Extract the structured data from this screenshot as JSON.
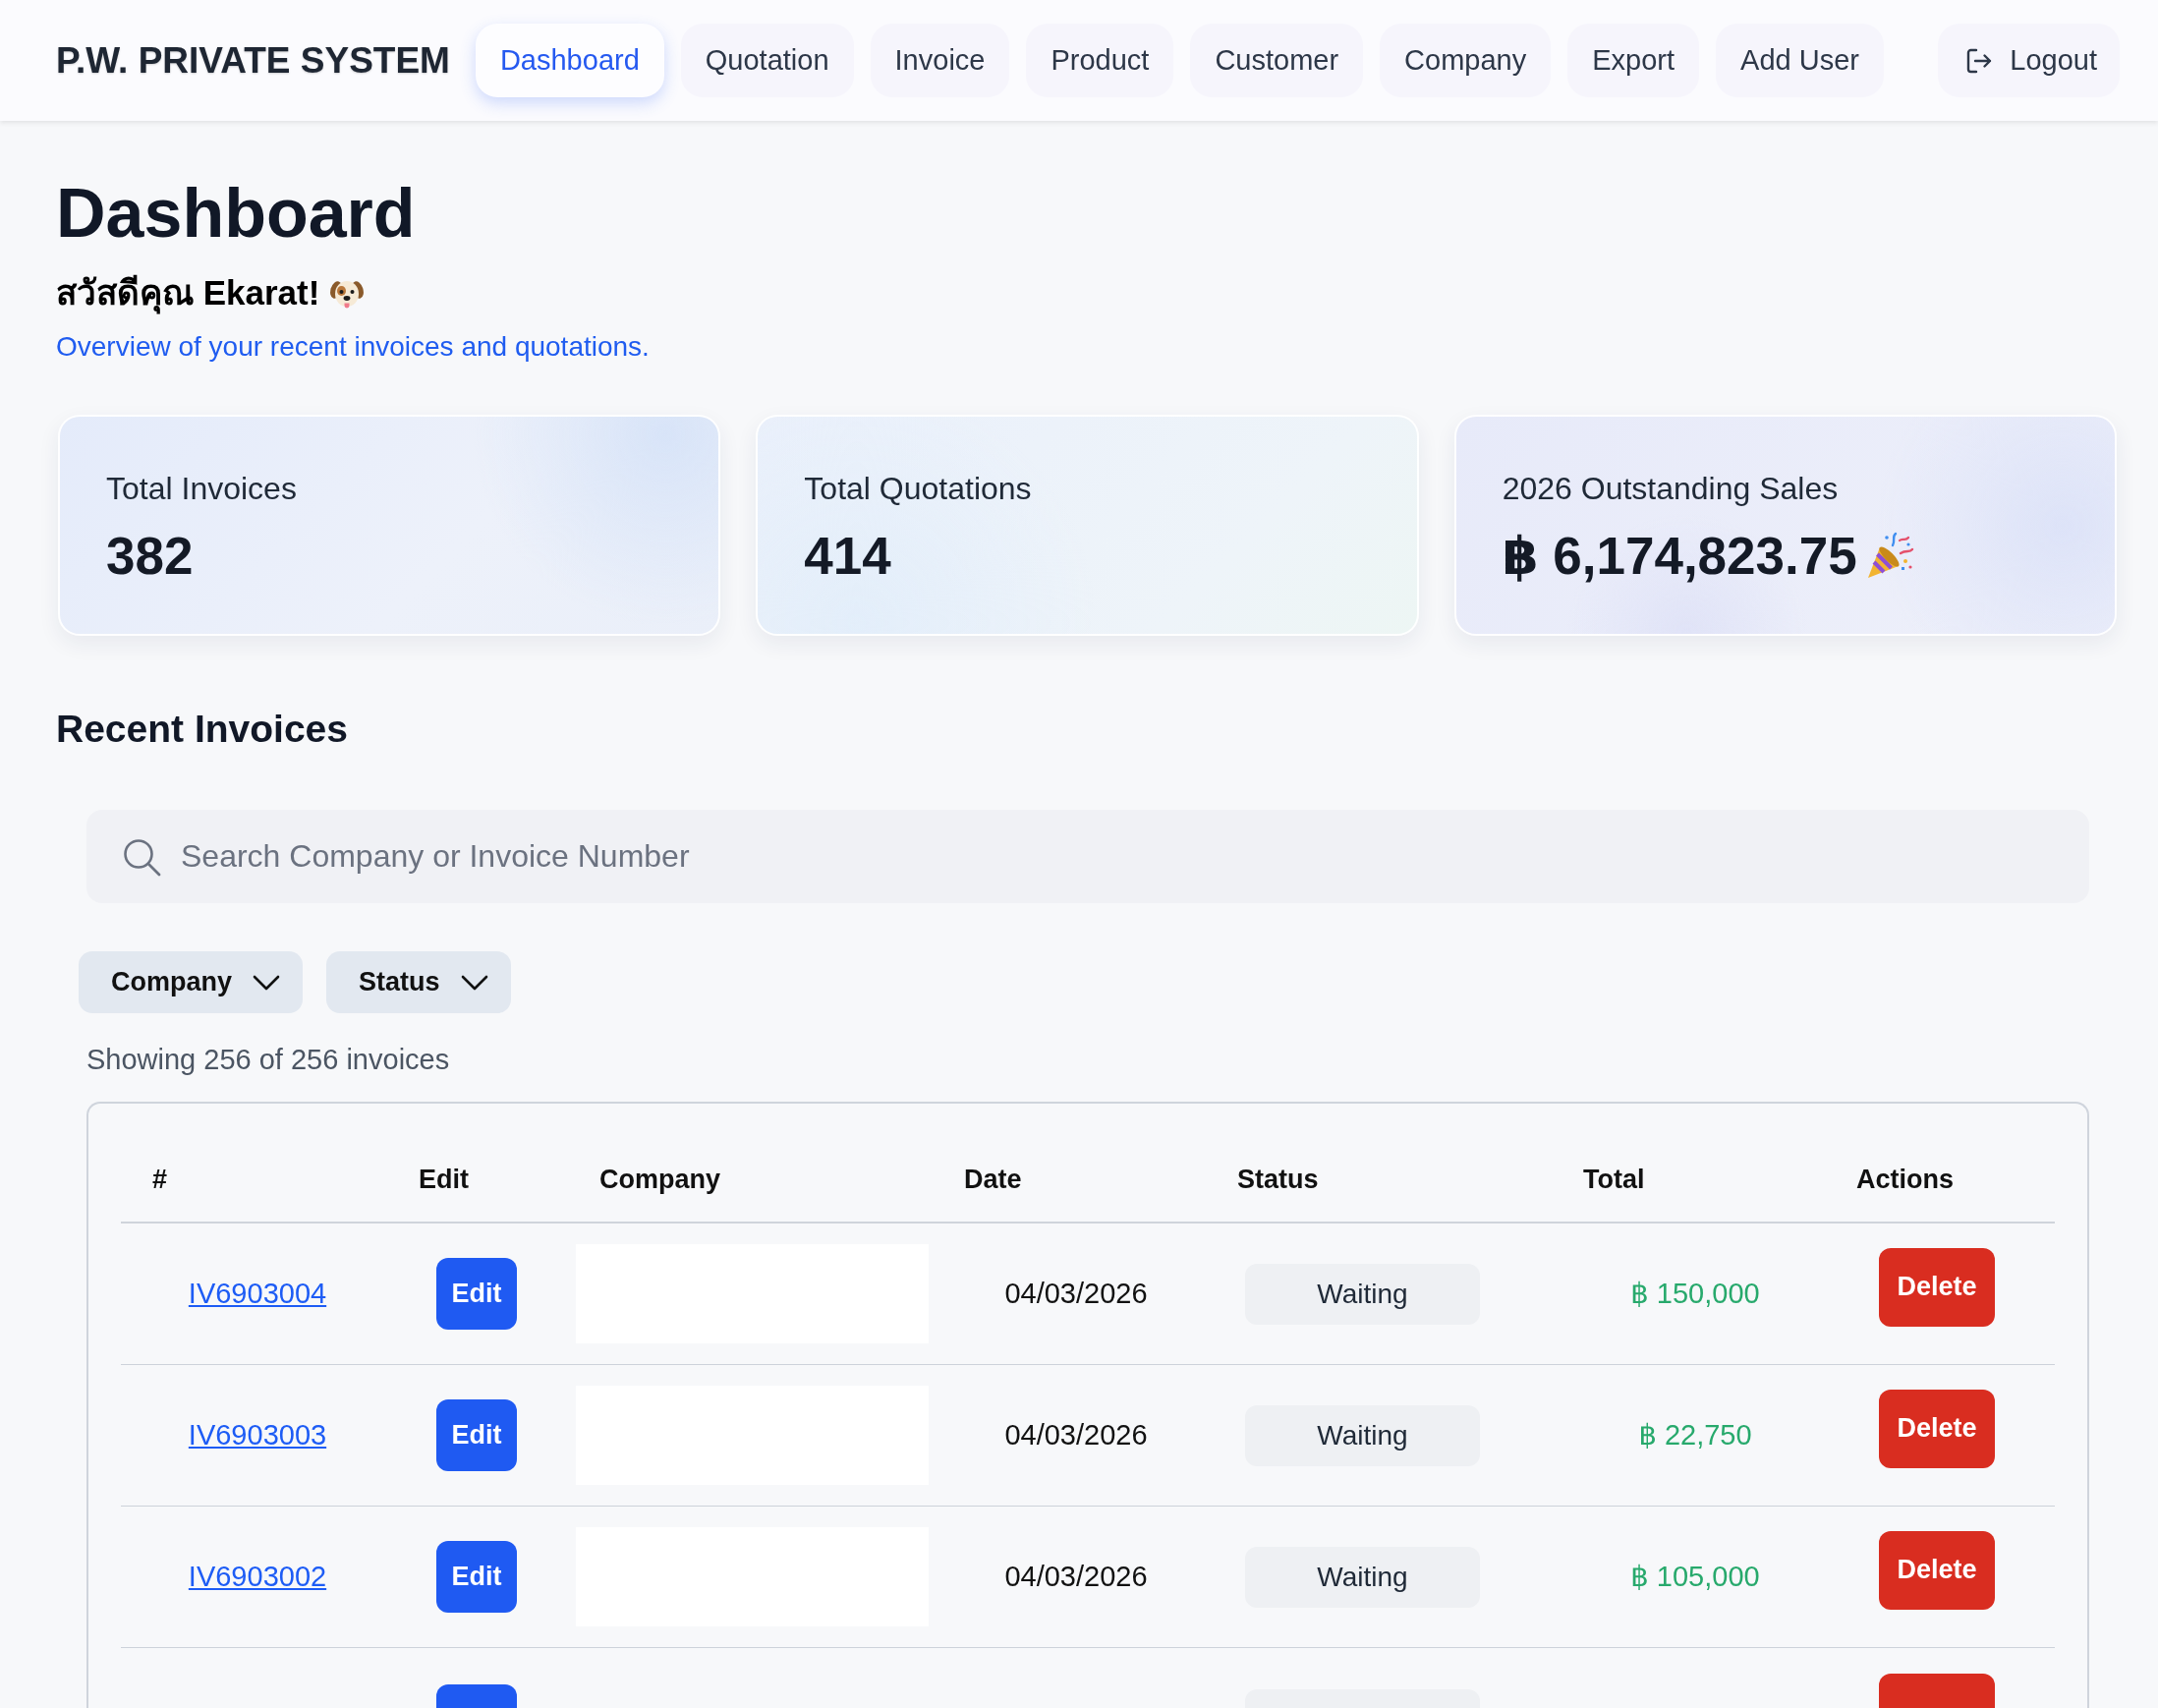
{
  "navbar": {
    "brand": "P.W. PRIVATE SYSTEM",
    "items": [
      {
        "label": "Dashboard",
        "selected": true
      },
      {
        "label": "Quotation",
        "selected": false
      },
      {
        "label": "Invoice",
        "selected": false
      },
      {
        "label": "Product",
        "selected": false
      },
      {
        "label": "Customer",
        "selected": false
      },
      {
        "label": "Company",
        "selected": false
      },
      {
        "label": "Export",
        "selected": false
      },
      {
        "label": "Add User",
        "selected": false
      }
    ],
    "logout": {
      "label": "Logout"
    }
  },
  "header": {
    "title": "Dashboard",
    "greeting": "สวัสดีคุณ Ekarat!",
    "subtitle": "Overview of your recent invoices and quotations."
  },
  "stats": [
    {
      "kind": "count",
      "label": "Total Invoices",
      "value": "382"
    },
    {
      "kind": "count",
      "label": "Total Quotations",
      "value": "414"
    },
    {
      "kind": "amount",
      "label": "2026 Outstanding Sales",
      "value": "฿ 6,174,823.75"
    }
  ],
  "recent_invoices": {
    "title": "Recent Invoices",
    "search": {
      "placeholder": "Search Company or Invoice Number"
    },
    "filters": [
      {
        "label": "Company"
      },
      {
        "label": "Status"
      }
    ],
    "summary": "Showing 256 of 256 invoices",
    "table": {
      "columns": [
        "#",
        "Edit",
        "Company",
        "Date",
        "Status",
        "Total",
        "Actions"
      ],
      "rows": [
        {
          "kind": "full",
          "invoice": "IV6903004",
          "edit": "Edit",
          "date": "04/03/2026",
          "status": "Waiting",
          "total": "฿ 150,000",
          "delete": "Delete"
        },
        {
          "kind": "full",
          "invoice": "IV6903003",
          "edit": "Edit",
          "date": "04/03/2026",
          "status": "Waiting",
          "total": "฿ 22,750",
          "delete": "Delete"
        },
        {
          "kind": "full",
          "invoice": "IV6903002",
          "edit": "Edit",
          "date": "04/03/2026",
          "status": "Waiting",
          "total": "฿ 105,000",
          "delete": "Delete"
        },
        {
          "kind": "partial"
        }
      ]
    }
  }
}
